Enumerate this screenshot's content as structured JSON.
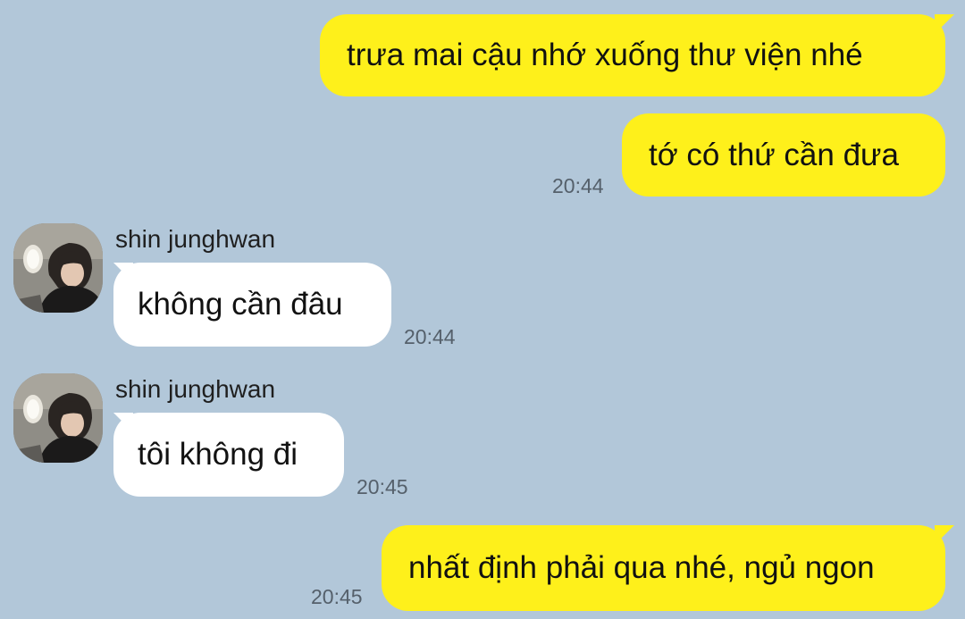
{
  "messages": [
    {
      "from": "me",
      "text": "trưa mai cậu nhớ xuống thư viện nhé",
      "time": ""
    },
    {
      "from": "me",
      "text": "tớ có thứ cần đưa",
      "time": "20:44"
    },
    {
      "from": "shin junghwan",
      "text": "không cần đâu",
      "time": "20:44"
    },
    {
      "from": "shin junghwan",
      "text": "tôi không đi",
      "time": "20:45"
    },
    {
      "from": "me",
      "text": "nhất định phải qua nhé, ngủ ngon",
      "time": "20:45"
    }
  ],
  "contact": {
    "name": "shin junghwan",
    "avatar_icon": "profile-photo"
  },
  "colors": {
    "background": "#b2c7d9",
    "my_bubble": "#fef01b",
    "their_bubble": "#ffffff",
    "timestamp": "#55606b"
  }
}
